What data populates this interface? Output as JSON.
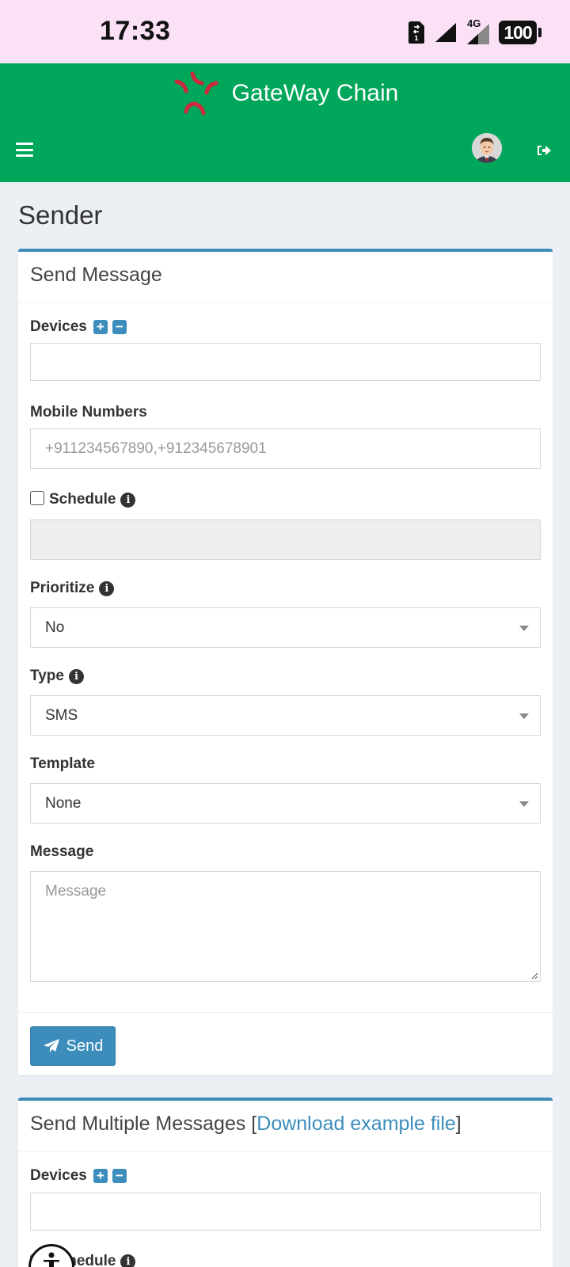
{
  "status_bar": {
    "time": "17:33",
    "network": "4G",
    "battery": "100"
  },
  "header": {
    "title": "GateWay Chain",
    "logo_icon": "angry-burst-icon",
    "menu_icon": "hamburger-icon",
    "logout_icon": "sign-out-icon"
  },
  "page": {
    "title": "Sender"
  },
  "send_message": {
    "title": "Send Message",
    "devices_label": "Devices",
    "devices_value": "",
    "mobile_numbers_label": "Mobile Numbers",
    "mobile_numbers_placeholder": "+911234567890,+912345678901",
    "schedule_label": "Schedule",
    "schedule_checked": false,
    "schedule_value": "",
    "prioritize_label": "Prioritize",
    "prioritize_value": "No",
    "type_label": "Type",
    "type_value": "SMS",
    "template_label": "Template",
    "template_value": "None",
    "message_label": "Message",
    "message_placeholder": "Message",
    "send_button": "Send"
  },
  "send_multiple": {
    "title_prefix": "Send Multiple Messages [",
    "title_link": "Download example file",
    "title_suffix": "]",
    "devices_label": "Devices",
    "devices_value": "",
    "schedule_label": "Schedule"
  },
  "colors": {
    "header": "#00a65a",
    "status_bar": "#fbe1f6",
    "primary": "#3c8dbc",
    "background": "#ecf0f5"
  }
}
